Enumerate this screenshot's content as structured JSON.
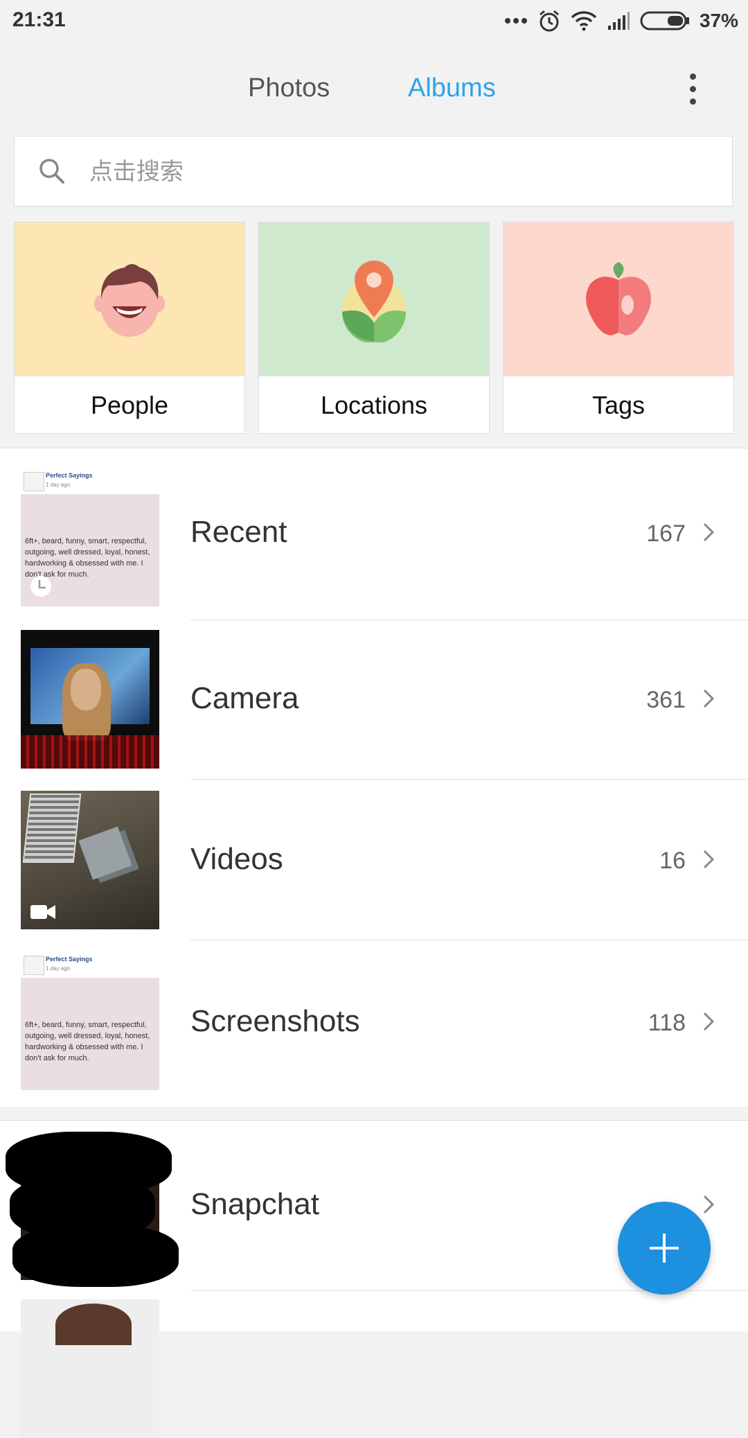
{
  "status_bar": {
    "time": "21:31",
    "battery_percent": "37%"
  },
  "tabs": [
    {
      "label": "Photos",
      "active": false
    },
    {
      "label": "Albums",
      "active": true
    }
  ],
  "search": {
    "placeholder": "点击搜索"
  },
  "categories": [
    {
      "label": "People"
    },
    {
      "label": "Locations"
    },
    {
      "label": "Tags"
    }
  ],
  "albums": [
    {
      "name": "Recent",
      "count": "167"
    },
    {
      "name": "Camera",
      "count": "361"
    },
    {
      "name": "Videos",
      "count": "16"
    },
    {
      "name": "Screenshots",
      "count": "118"
    },
    {
      "name": "Snapchat",
      "count": ""
    }
  ],
  "thumb_post": {
    "title": "Perfect Sayings",
    "subtitle": "1 day ago",
    "text": "6ft+, beard, funny, smart, respectful, outgoing, well dressed, loyal, honest, hardworking & obsessed with me. I don't ask for much."
  },
  "colors": {
    "accent": "#2ea4e8",
    "fab": "#1e90e0"
  }
}
